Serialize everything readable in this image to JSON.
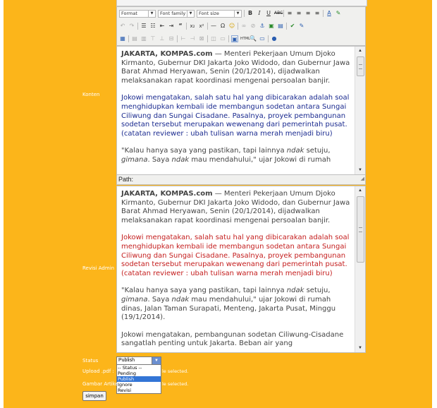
{
  "toolbar": {
    "format_label": "Format",
    "font_family_label": "Font family",
    "font_size_label": "Font size"
  },
  "labels": {
    "konten": "Konten",
    "revisi_admin": "Revisi Admin",
    "status": "Status",
    "upload_pdf": "Upload .pdf :",
    "gambar_artikel": "Gambar Artikel :"
  },
  "editor_konten": {
    "p1_lead": "JAKARTA, KOMPAS.com",
    "p1_rest": " — Menteri Pekerjaan Umum Djoko Kirmanto, Gubernur DKI Jakarta Joko Widodo, dan Gubernur Jawa Barat Ahmad Heryawan, Senin (20/1/2014), dijadwalkan melaksanakan rapat koordinasi mengenai persoalan banjir.",
    "p2": "Jokowi mengatakan, salah satu hal yang dibicarakan adalah soal menghidupkan kembali ide membangun sodetan antara Sungai Ciliwung dan Sungai Cisadane. Pasalnya, proyek pembangunan sodetan tersebut merupakan wewenang dari pemerintah pusat. (catatan reviewer : ubah tulisan warna merah menjadi biru)",
    "p3_a": "\"Kalau hanya saya yang pastikan, tapi lainnya ",
    "p3_i1": "ndak",
    "p3_b": " setuju, ",
    "p3_i2": "gimana",
    "p3_c": ". Saya ",
    "p3_i3": "ndak",
    "p3_d": " mau mendahului,\" ujar Jokowi di rumah"
  },
  "path_label": "Path:",
  "editor_revisi": {
    "p1_lead": "JAKARTA, KOMPAS.com",
    "p1_rest": " — Menteri Pekerjaan Umum Djoko Kirmanto, Gubernur DKI Jakarta Joko Widodo, dan Gubernur Jawa Barat Ahmad Heryawan, Senin (20/1/2014), dijadwalkan melaksanakan rapat koordinasi mengenai persoalan banjir.",
    "p2": "Jokowi mengatakan, salah satu hal yang dibicarakan adalah soal menghidupkan kembali ide membangun sodetan antara Sungai Ciliwung dan Sungai Cisadane. Pasalnya, proyek pembangunan sodetan tersebut merupakan wewenang dari pemerintah pusat. (catatan reviewer : ubah tulisan warna merah menjadi biru)",
    "p3_a": "\"Kalau hanya saya yang pastikan, tapi lainnya ",
    "p3_i1": "ndak",
    "p3_b": " setuju, ",
    "p3_i2": "gimana",
    "p3_c": ". Saya ",
    "p3_i3": "ndak",
    "p3_d": " mau mendahului,\" ujar Jokowi di rumah dinas, Jalan Taman Surapati, Menteng, Jakarta Pusat, Minggu (19/1/2014).",
    "p4": "Jokowi mengatakan, pembangunan sodetan Ciliwung-Cisadane sangatlah penting untuk Jakarta. Beban air yang"
  },
  "status": {
    "selected": "Publish",
    "options": [
      "-- Status --",
      "Pending",
      "Publish",
      "Ignore",
      "Revisi"
    ]
  },
  "file_inputs": {
    "upload_suffix": "le selected.",
    "gambar_suffix": "le selected."
  },
  "submit_label": "simpan",
  "colors": {
    "background": "#fcb51a",
    "konten_p2": "#1a2a8f",
    "revisi_p2": "#c41e1e"
  }
}
